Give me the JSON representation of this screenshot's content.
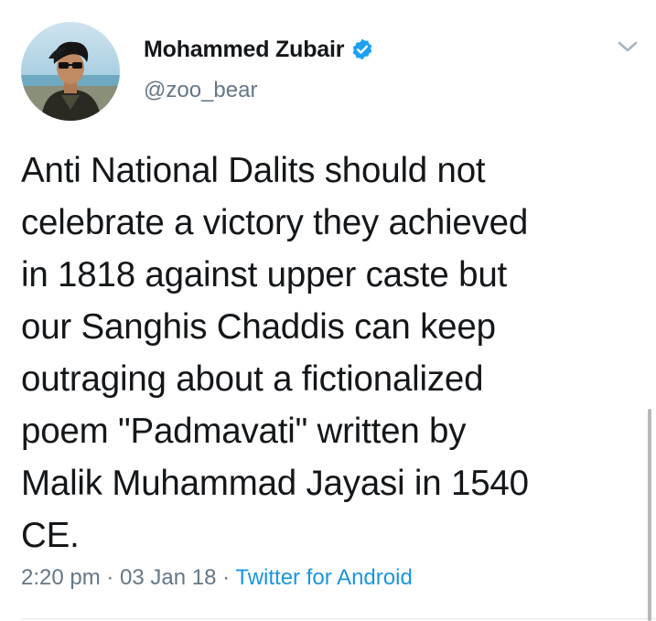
{
  "user": {
    "display_name": "Mohammed Zubair",
    "handle": "@zoo_bear",
    "verified": true
  },
  "tweet": {
    "text": "Anti National Dalits should not\ncelebrate a victory they achieved\nin 1818 against upper caste but\nour Sanghis Chaddis can keep\noutraging about a fictionalized\npoem  \"Padmavati\" written by\nMalik Muhammad Jayasi in 1540\nCE.",
    "time": "2:20 pm",
    "separator": " · ",
    "date": "03 Jan 18",
    "source": "Twitter for Android"
  },
  "icons": {
    "verified": "verified-badge-icon",
    "menu": "chevron-down-icon"
  },
  "colors": {
    "link": "#1b95e0",
    "muted": "#657786",
    "text": "#14171a",
    "verified": "#1da1f2"
  }
}
